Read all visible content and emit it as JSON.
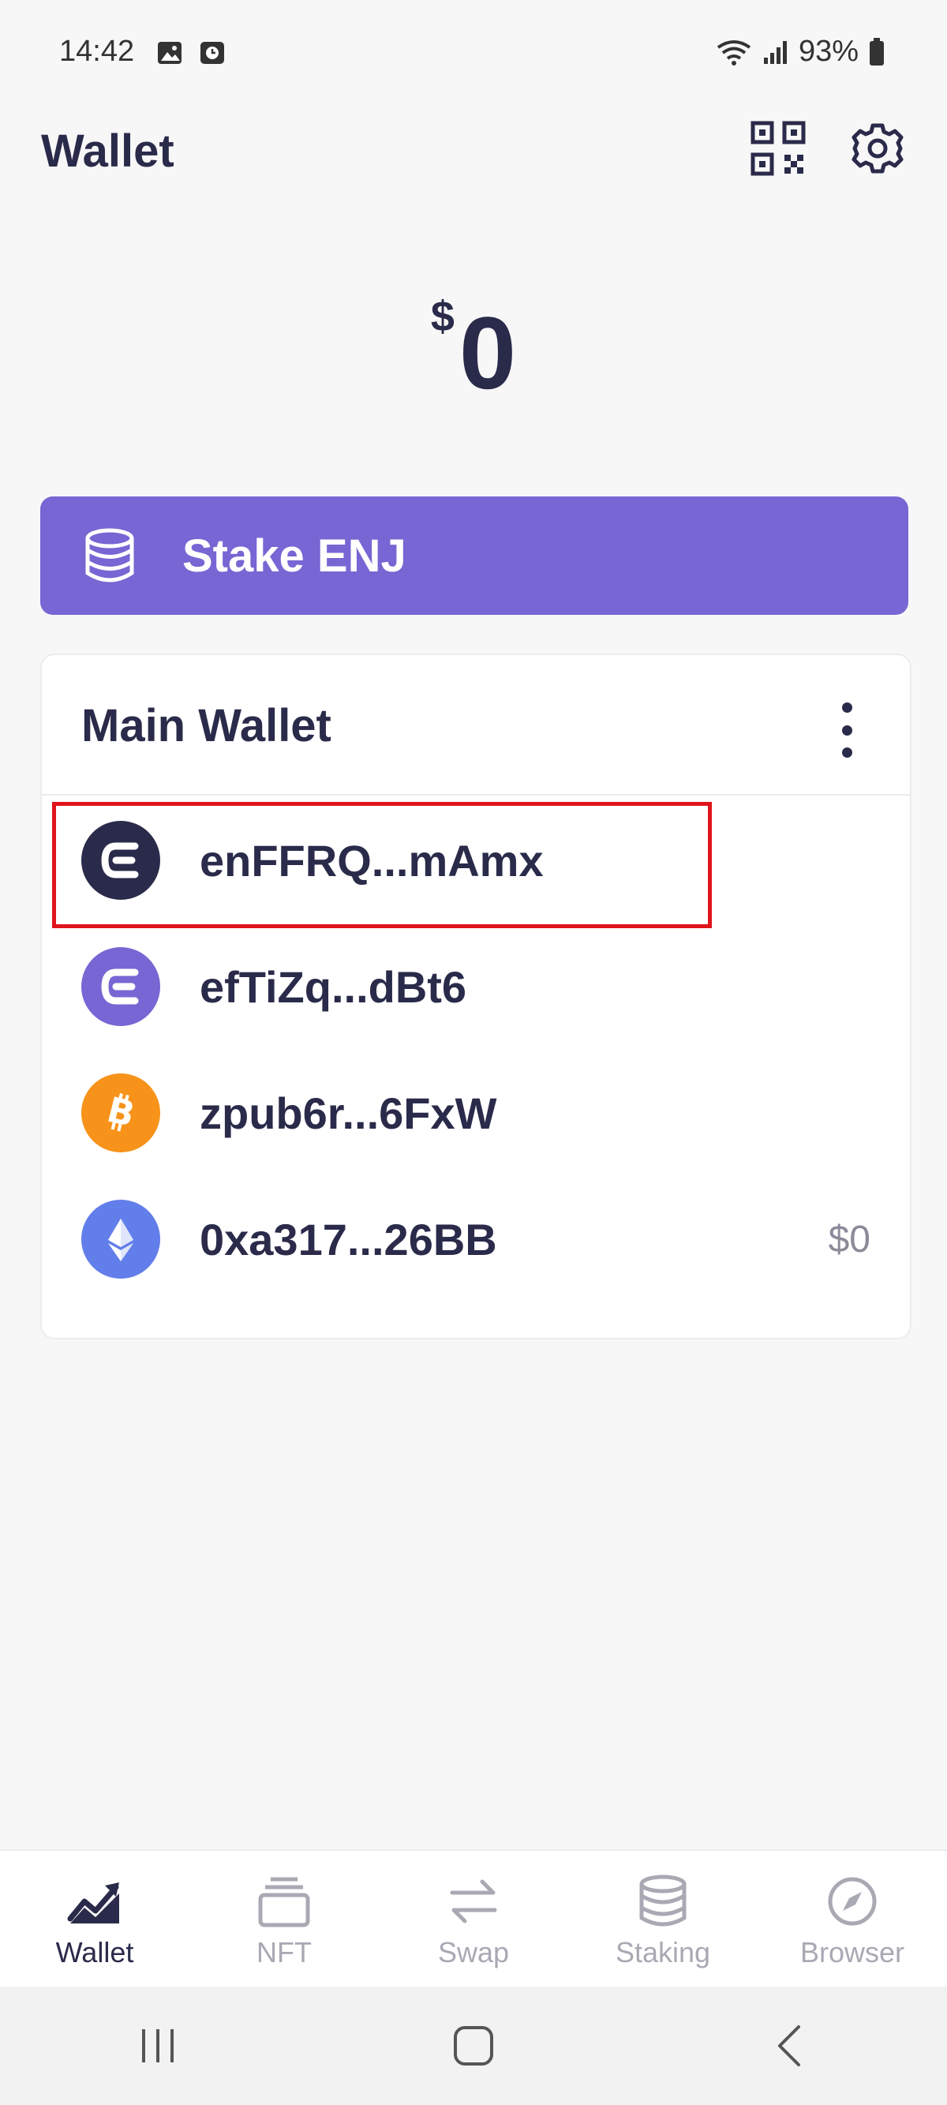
{
  "status_bar": {
    "time": "14:42",
    "battery": "93%"
  },
  "header": {
    "title": "Wallet"
  },
  "balance": {
    "currency": "$",
    "amount": "0"
  },
  "stake_banner": {
    "label": "Stake ENJ"
  },
  "wallet_card": {
    "title": "Main Wallet",
    "rows": [
      {
        "address": "enFFRQ...mAmx",
        "coin": "enjin-dark",
        "value": ""
      },
      {
        "address": "efTiZq...dBt6",
        "coin": "enjin-purple",
        "value": ""
      },
      {
        "address": "zpub6r...6FxW",
        "coin": "bitcoin",
        "value": ""
      },
      {
        "address": "0xa317...26BB",
        "coin": "ethereum",
        "value": "$0"
      }
    ]
  },
  "bottom_nav": [
    {
      "label": "Wallet",
      "icon": "chart-trend-icon",
      "active": true
    },
    {
      "label": "NFT",
      "icon": "nft-stack-icon",
      "active": false
    },
    {
      "label": "Swap",
      "icon": "swap-arrows-icon",
      "active": false
    },
    {
      "label": "Staking",
      "icon": "database-coins-icon",
      "active": false
    },
    {
      "label": "Browser",
      "icon": "compass-icon",
      "active": false
    }
  ],
  "colors": {
    "accent": "#7766d3",
    "text_dark": "#2a2a4a",
    "bitcoin": "#f7931a",
    "ethereum": "#627eea",
    "highlight": "#e0151b",
    "nav_inactive": "#a9a9b4"
  }
}
